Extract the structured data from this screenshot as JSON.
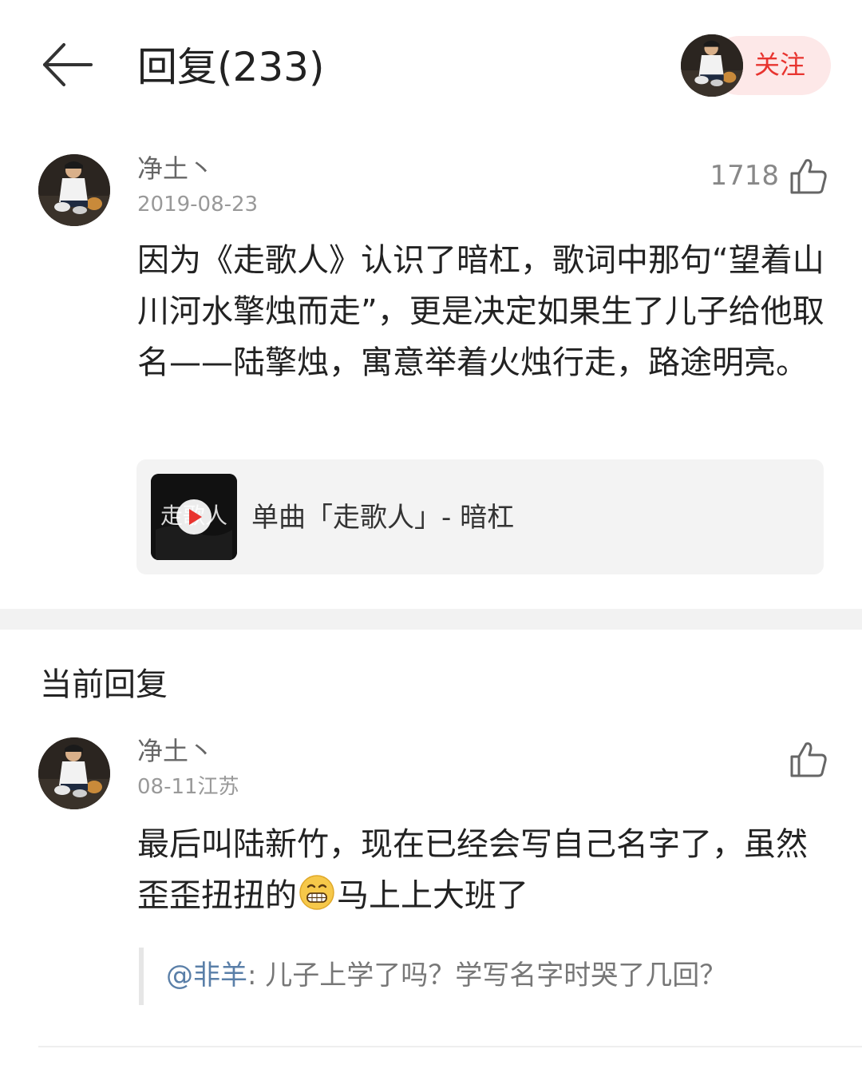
{
  "header": {
    "title": "回复(233)",
    "follow_label": "关注",
    "back_icon": "arrow-left-icon"
  },
  "main_comment": {
    "user": "净土丶",
    "date": "2019-08-23",
    "likes": "1718",
    "text": "因为《走歌人》认识了暗杠，歌词中那句“望着山川河水擎烛而走”，更是决定如果生了儿子给他取名——陆擎烛，寓意举着火烛行走，路途明亮。",
    "song": {
      "label": "单曲「走歌人」- 暗杠",
      "cover_text": "走歌人"
    }
  },
  "current_reply": {
    "section_title": "当前回复",
    "user": "净土丶",
    "meta": "08-11江苏",
    "text_before_emoji": "最后叫陆新竹，现在已经会写自己名字了，虽然歪歪扭扭的",
    "emoji": "grinning-face-icon",
    "text_after_emoji": "马上上大班了",
    "quote": {
      "mention": "@非羊",
      "separator": ": ",
      "text": "儿子上学了吗？学写名字时哭了几回？"
    }
  },
  "colors": {
    "accent_red": "#e8342f",
    "follow_bg": "#fde8e8",
    "mention_blue": "#5a7fa8",
    "card_bg": "#f3f3f3"
  }
}
